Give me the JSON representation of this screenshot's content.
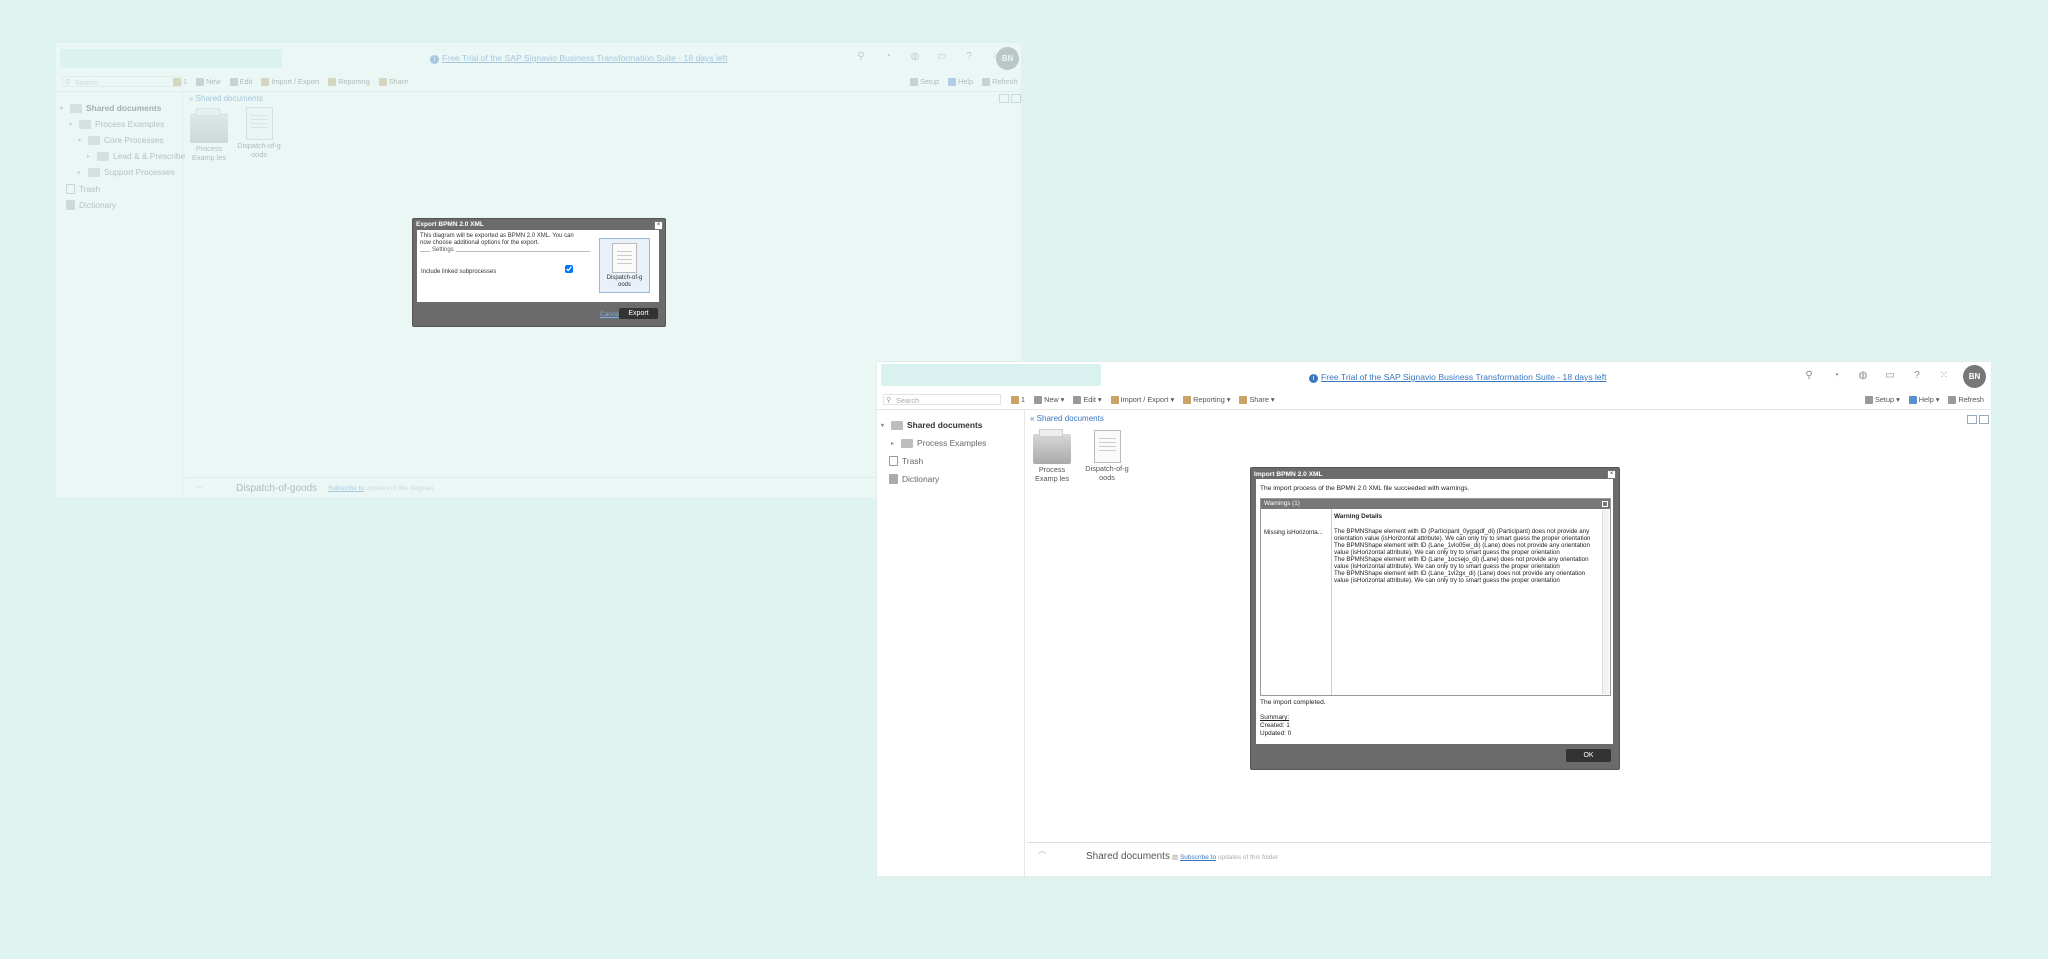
{
  "trial_banner": "Free Trial of the SAP Signavio Business Transformation Suite - 18 days left",
  "user_initials": "BN",
  "search": {
    "placeholder": "Search"
  },
  "toolbar": {
    "count": "1",
    "new": "New",
    "edit": "Edit",
    "import_export": "Import / Export",
    "reporting": "Reporting",
    "share": "Share",
    "setup": "Setup",
    "help": "Help",
    "refresh": "Refresh"
  },
  "sidebar_back": [
    "Shared documents",
    "Process Examples",
    "Core Processes",
    "Lead & & Prescribe",
    "Support Processes",
    "Trash",
    "Dictionary"
  ],
  "sidebar_front": [
    "Shared documents",
    "Process Examples",
    "Trash",
    "Dictionary"
  ],
  "breadcrumb": "« Shared documents",
  "tiles": [
    {
      "label": "Process Examples",
      "kind": "folder"
    },
    {
      "label": "Dispatch-of-goods",
      "kind": "diagram"
    }
  ],
  "tiles_back_labels": [
    "Process Examp les",
    "Dispatch-of-g oods"
  ],
  "tiles_front_labels": [
    "Process Examp les",
    "Dispatch-of-g oods"
  ],
  "footer_back": {
    "title": "Dispatch-of-goods",
    "link": "Subscribe to",
    "text": "updates of this diagram"
  },
  "footer_front": {
    "title": "Shared documents",
    "link": "Subscribe to",
    "text": "updates of this folder"
  },
  "export_dialog": {
    "title": "Export BPMN 2.0 XML",
    "description": "This diagram will be exported as BPMN 2.0 XML. You can now choose additional options for the export.",
    "settings_legend": "Settings",
    "checkbox_label": "Include linked subprocesses",
    "checkbox_checked": true,
    "preview_label": "Dispatch-of-g oods",
    "cancel": "Cancel",
    "export": "Export"
  },
  "import_dialog": {
    "title": "Import BPMN 2.0 XML",
    "intro": "The import process of the BPMN 2.0 XML file succeeded with warnings.",
    "warnings_header": "Warnings (1)",
    "col_details": "Warning Details",
    "row_label": "Missing isHorizonta...",
    "messages": [
      "The BPMNShape element with ID (Participant_0ygsgdf_di) (Participant) does not provide any orientation value (isHorizontal attribute). We can only try to smart guess the proper orientation",
      "The BPMNShape element with ID (Lane_1vlo05w_di) (Lane) does not provide any orientation value (isHorizontal attribute). We can only try to smart guess the proper orientation",
      "The BPMNShape element with ID (Lane_1ocsejo_di) (Lane) does not provide any orientation value (isHorizontal attribute). We can only try to smart guess the proper orientation",
      "The BPMNShape element with ID (Lane_1vl2gx_di) (Lane) does not provide any orientation value (isHorizontal attribute). We can only try to smart guess the proper orientation"
    ],
    "completed": "The import completed.",
    "summary_label": "Summary:",
    "created": "Created: 1",
    "updated": "Updated: 0",
    "ok": "OK"
  }
}
